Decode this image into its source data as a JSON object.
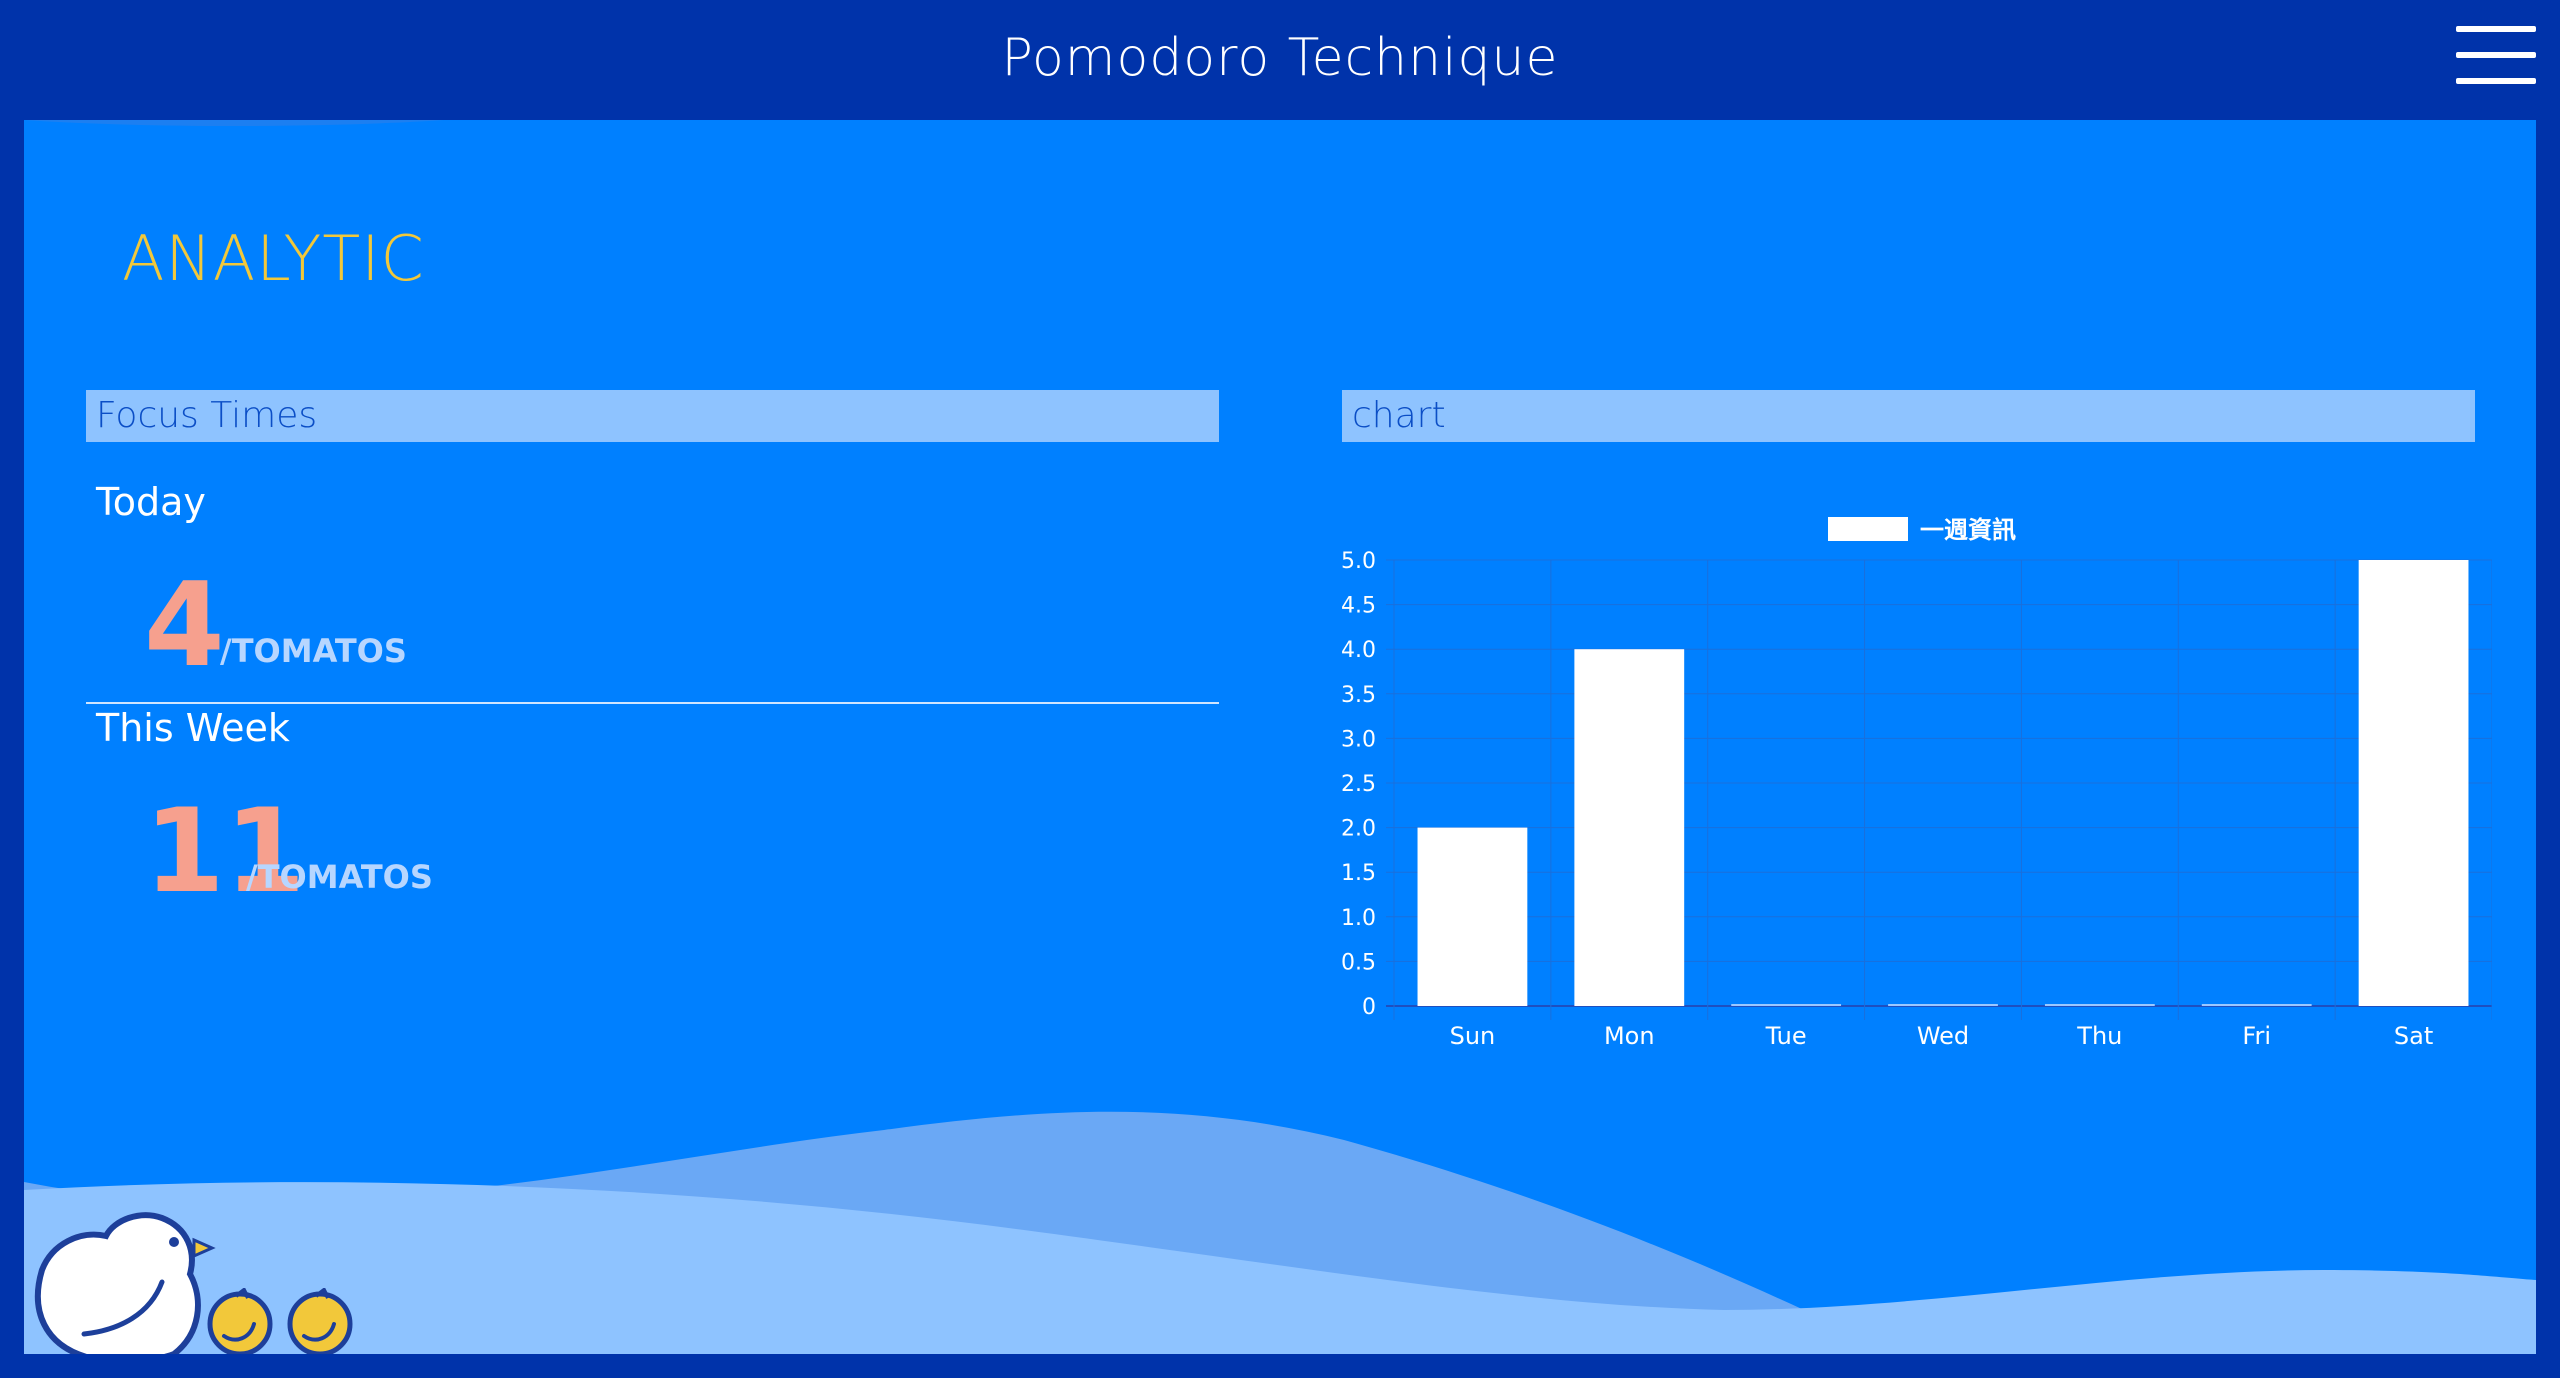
{
  "header": {
    "title": "Pomodoro Technique",
    "menu_icon": "hamburger-menu-icon"
  },
  "page": {
    "section_title": "ANALYTIC"
  },
  "focus_panel": {
    "header": "Focus Times",
    "today_label": "Today",
    "today_count": "4",
    "today_unit": "/TOMATOS",
    "week_label": "This Week",
    "week_count": "11",
    "week_unit": "/TOMATOS"
  },
  "chart_panel": {
    "header": "chart"
  },
  "colors": {
    "frame": "#0033aa",
    "background": "#0080ff",
    "panel_header": "#8ec3ff",
    "accent_title": "#f2c83a",
    "count": "#f6a08e",
    "bar": "#ffffff"
  },
  "chart_data": {
    "type": "bar",
    "categories": [
      "Sun",
      "Mon",
      "Tue",
      "Wed",
      "Thu",
      "Fri",
      "Sat"
    ],
    "series": [
      {
        "name": "一週資訊",
        "values": [
          2,
          4,
          0,
          0,
          0,
          0,
          5
        ]
      }
    ],
    "ylim": [
      0,
      5
    ],
    "yticks": [
      "5.0",
      "4.5",
      "4.0",
      "3.5",
      "3.0",
      "2.5",
      "2.0",
      "1.5",
      "1.0",
      "0.5",
      "0"
    ],
    "grid": true,
    "legend": "top-center"
  },
  "decorations": {
    "mascot": "chick-mascot-icon",
    "tomatoes": [
      "tomato-icon",
      "tomato-icon"
    ]
  }
}
